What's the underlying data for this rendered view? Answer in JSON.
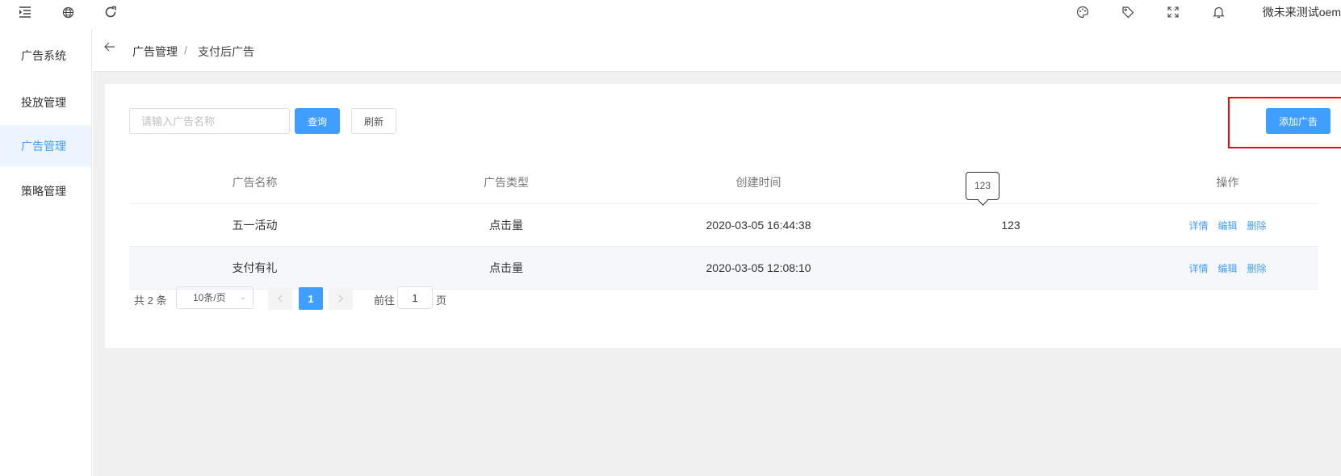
{
  "topbar": {
    "user_name": "微未来测试oem",
    "icons": [
      "menu-collapse-icon",
      "globe-icon",
      "refresh-icon",
      "palette-icon",
      "tag-icon",
      "fullscreen-icon",
      "bell-icon"
    ]
  },
  "sidebar": {
    "title": "广告系统",
    "items": [
      {
        "label": "投放管理",
        "active": false
      },
      {
        "label": "广告管理",
        "active": true
      },
      {
        "label": "策略管理",
        "active": false
      }
    ]
  },
  "breadcrumb": {
    "level1": "广告管理",
    "separator": "/",
    "level2": "支付后广告"
  },
  "toolbar": {
    "search_placeholder": "请输入广告名称",
    "search_value": "",
    "query_label": "查询",
    "refresh_label": "刷新",
    "add_label": "添加广告"
  },
  "table": {
    "headers": [
      "广告名称",
      "广告类型",
      "创建时间",
      "",
      "操作"
    ],
    "rows": [
      {
        "name": "五一活动",
        "type": "点击量",
        "created": "2020-03-05 16:44:38",
        "extra": "123",
        "ops": [
          "详情",
          "编辑",
          "删除"
        ]
      },
      {
        "name": "支付有礼",
        "type": "点击量",
        "created": "2020-03-05 12:08:10",
        "extra": "",
        "ops": [
          "详情",
          "编辑",
          "删除"
        ]
      }
    ],
    "tooltip": "123"
  },
  "pagination": {
    "total_text": "共 2 条",
    "page_size": "10条/页",
    "current_page": "1",
    "goto_label": "前往",
    "goto_value": "1",
    "page_suffix": "页"
  },
  "colors": {
    "primary": "#409eff",
    "highlight": "#ff0000",
    "background": "#f0f0f0"
  }
}
